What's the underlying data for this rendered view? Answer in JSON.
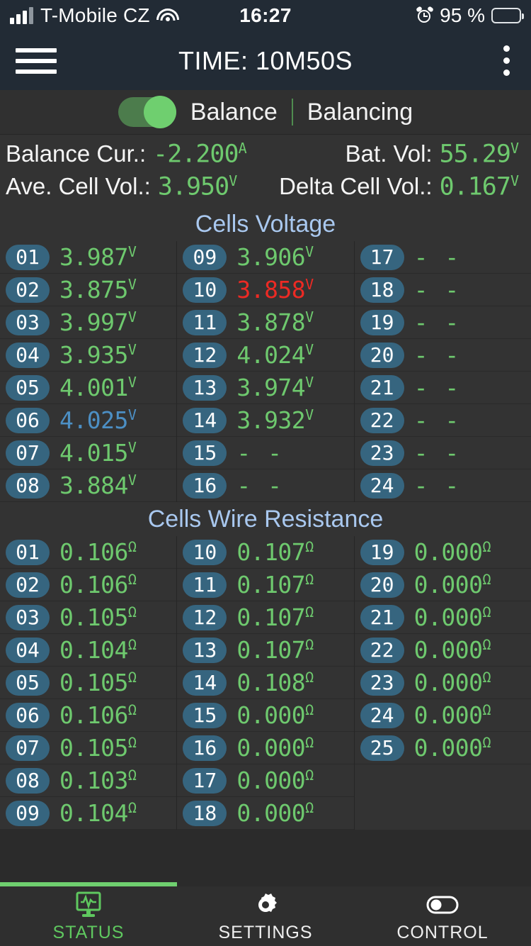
{
  "statusbar": {
    "carrier": "T-Mobile CZ",
    "time": "16:27",
    "battery_pct": "95 %",
    "icons": [
      "signal-icon",
      "wifi-icon",
      "alarm-icon",
      "battery-icon"
    ]
  },
  "titlebar": {
    "menu_icon": "hamburger-menu-icon",
    "title": "TIME: 10M50S",
    "overflow_icon": "kebab-menu-icon"
  },
  "balance": {
    "toggle_on": true,
    "label": "Balance",
    "status": "Balancing"
  },
  "summary": {
    "rows": [
      {
        "label": "Balance Cur.:",
        "value": "-2.200",
        "unit": "A"
      },
      {
        "label": "Bat. Vol:",
        "value": "55.29",
        "unit": "V"
      },
      {
        "label": "Ave. Cell Vol.:",
        "value": "3.950",
        "unit": "V"
      },
      {
        "label": "Delta Cell Vol.:",
        "value": "0.167",
        "unit": "V"
      }
    ]
  },
  "cells_voltage": {
    "title": "Cells Voltage",
    "unit": "V",
    "columns": [
      [
        {
          "id": "01",
          "value": "3.987",
          "unit": "V",
          "state": "normal"
        },
        {
          "id": "02",
          "value": "3.875",
          "unit": "V",
          "state": "normal"
        },
        {
          "id": "03",
          "value": "3.997",
          "unit": "V",
          "state": "normal"
        },
        {
          "id": "04",
          "value": "3.935",
          "unit": "V",
          "state": "normal"
        },
        {
          "id": "05",
          "value": "4.001",
          "unit": "V",
          "state": "normal"
        },
        {
          "id": "06",
          "value": "4.025",
          "unit": "V",
          "state": "max"
        },
        {
          "id": "07",
          "value": "4.015",
          "unit": "V",
          "state": "normal"
        },
        {
          "id": "08",
          "value": "3.884",
          "unit": "V",
          "state": "normal"
        }
      ],
      [
        {
          "id": "09",
          "value": "3.906",
          "unit": "V",
          "state": "normal"
        },
        {
          "id": "10",
          "value": "3.858",
          "unit": "V",
          "state": "min"
        },
        {
          "id": "11",
          "value": "3.878",
          "unit": "V",
          "state": "normal"
        },
        {
          "id": "12",
          "value": "4.024",
          "unit": "V",
          "state": "normal"
        },
        {
          "id": "13",
          "value": "3.974",
          "unit": "V",
          "state": "normal"
        },
        {
          "id": "14",
          "value": "3.932",
          "unit": "V",
          "state": "normal"
        },
        {
          "id": "15",
          "value": "- -",
          "unit": "",
          "state": "na"
        },
        {
          "id": "16",
          "value": "- -",
          "unit": "",
          "state": "na"
        }
      ],
      [
        {
          "id": "17",
          "value": "- -",
          "unit": "",
          "state": "na"
        },
        {
          "id": "18",
          "value": "- -",
          "unit": "",
          "state": "na"
        },
        {
          "id": "19",
          "value": "- -",
          "unit": "",
          "state": "na"
        },
        {
          "id": "20",
          "value": "- -",
          "unit": "",
          "state": "na"
        },
        {
          "id": "21",
          "value": "- -",
          "unit": "",
          "state": "na"
        },
        {
          "id": "22",
          "value": "- -",
          "unit": "",
          "state": "na"
        },
        {
          "id": "23",
          "value": "- -",
          "unit": "",
          "state": "na"
        },
        {
          "id": "24",
          "value": "- -",
          "unit": "",
          "state": "na"
        }
      ]
    ]
  },
  "cells_resistance": {
    "title": "Cells Wire Resistance",
    "unit": "Ω",
    "columns": [
      [
        {
          "id": "01",
          "value": "0.106",
          "unit": "Ω",
          "state": "normal"
        },
        {
          "id": "02",
          "value": "0.106",
          "unit": "Ω",
          "state": "normal"
        },
        {
          "id": "03",
          "value": "0.105",
          "unit": "Ω",
          "state": "normal"
        },
        {
          "id": "04",
          "value": "0.104",
          "unit": "Ω",
          "state": "normal"
        },
        {
          "id": "05",
          "value": "0.105",
          "unit": "Ω",
          "state": "normal"
        },
        {
          "id": "06",
          "value": "0.106",
          "unit": "Ω",
          "state": "normal"
        },
        {
          "id": "07",
          "value": "0.105",
          "unit": "Ω",
          "state": "normal"
        },
        {
          "id": "08",
          "value": "0.103",
          "unit": "Ω",
          "state": "normal"
        },
        {
          "id": "09",
          "value": "0.104",
          "unit": "Ω",
          "state": "normal"
        }
      ],
      [
        {
          "id": "10",
          "value": "0.107",
          "unit": "Ω",
          "state": "normal"
        },
        {
          "id": "11",
          "value": "0.107",
          "unit": "Ω",
          "state": "normal"
        },
        {
          "id": "12",
          "value": "0.107",
          "unit": "Ω",
          "state": "normal"
        },
        {
          "id": "13",
          "value": "0.107",
          "unit": "Ω",
          "state": "normal"
        },
        {
          "id": "14",
          "value": "0.108",
          "unit": "Ω",
          "state": "normal"
        },
        {
          "id": "15",
          "value": "0.000",
          "unit": "Ω",
          "state": "normal"
        },
        {
          "id": "16",
          "value": "0.000",
          "unit": "Ω",
          "state": "normal"
        },
        {
          "id": "17",
          "value": "0.000",
          "unit": "Ω",
          "state": "normal"
        },
        {
          "id": "18",
          "value": "0.000",
          "unit": "Ω",
          "state": "normal"
        }
      ],
      [
        {
          "id": "19",
          "value": "0.000",
          "unit": "Ω",
          "state": "normal"
        },
        {
          "id": "20",
          "value": "0.000",
          "unit": "Ω",
          "state": "normal"
        },
        {
          "id": "21",
          "value": "0.000",
          "unit": "Ω",
          "state": "normal"
        },
        {
          "id": "22",
          "value": "0.000",
          "unit": "Ω",
          "state": "normal"
        },
        {
          "id": "23",
          "value": "0.000",
          "unit": "Ω",
          "state": "normal"
        },
        {
          "id": "24",
          "value": "0.000",
          "unit": "Ω",
          "state": "normal"
        },
        {
          "id": "25",
          "value": "0.000",
          "unit": "Ω",
          "state": "normal"
        }
      ]
    ]
  },
  "tabbar": {
    "active_index": 0,
    "tabs": [
      {
        "label": "STATUS",
        "icon": "monitor-waveform-icon"
      },
      {
        "label": "SETTINGS",
        "icon": "gear-icon"
      },
      {
        "label": "CONTROL",
        "icon": "toggle-switch-icon"
      }
    ]
  },
  "colors": {
    "value_green": "#6ec96e",
    "value_min_red": "#ec2a24",
    "value_max_blue": "#4c8fc4",
    "section_title_blue": "#a9c8ef",
    "badge_blue": "#36657f",
    "accent_green": "#6fcf6f"
  }
}
